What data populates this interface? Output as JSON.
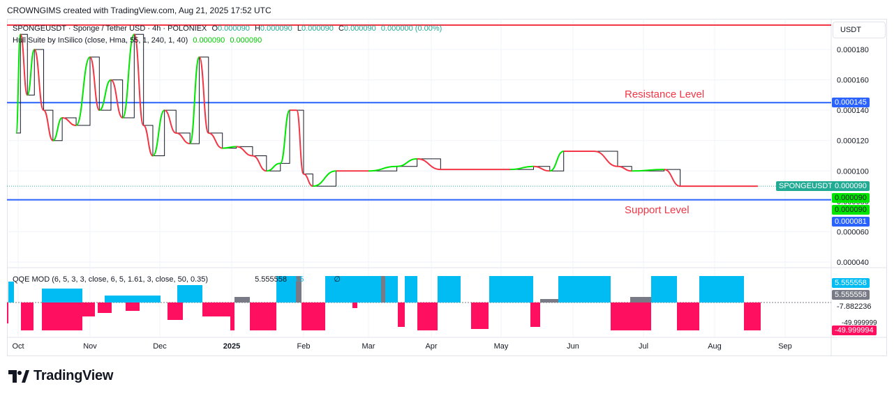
{
  "header": {
    "attribution": "CROWNGIMS created with TradingView.com, Aug 21, 2025 17:52 UTC"
  },
  "legend": {
    "symbol_line": "SPONGEUSDT · Sponge / Tether USD · 4h · POLONIEX",
    "o_label": "O",
    "o_value": "0.000090",
    "h_label": "H",
    "h_value": "0.000090",
    "l_label": "L",
    "l_value": "0.000090",
    "c_label": "C",
    "c_value": "0.000090",
    "change": "0.000000 (0.00%)",
    "indicator": "Hull Suite by InSilico (close, Hma, 55, 1, 240, 1, 40)",
    "indicator_v1": "0.000090",
    "indicator_v2": "0.000090",
    "qqe": "QQE MOD (6, 5, 3, 3, close, 6, 5, 1.61, 3, close, 50, 0.35)",
    "qqe_v1": "5.555558",
    "qqe_v2": "5.5",
    "qqe_symbol": "∅"
  },
  "annotations": {
    "resistance": "Resistance Level",
    "support": "Support Level"
  },
  "price_axis": {
    "currency": "USDT",
    "ticks": [
      "0.000180",
      "0.000160",
      "0.000140",
      "0.000120",
      "0.000100",
      "0.000080",
      "0.000060",
      "0.000040"
    ],
    "tags": {
      "resistance": "0.000145",
      "symbol": "SPONGEUSDT",
      "last": "0.000090",
      "hull1": "0.000090",
      "hull2": "0.000090",
      "support": "0.000081"
    }
  },
  "qqe_axis": {
    "v1": "5.555558",
    "v2": "5.555558",
    "v3": "-7.882236",
    "v4": "-49.999994",
    "v4_under": "-49.999999"
  },
  "time_axis": [
    "Oct",
    "Nov",
    "Dec",
    "2025",
    "Feb",
    "Mar",
    "Apr",
    "May",
    "Jun",
    "Jul",
    "Aug",
    "Sep"
  ],
  "colors": {
    "resistance_line": "#2962ff",
    "support_line": "#2962ff",
    "top_line": "#f23645",
    "hull_up": "#00e600",
    "hull_down": "#f23645",
    "price": "#131722",
    "qqe_up": "#00bcf2",
    "qqe_down": "#ff0f5f",
    "qqe_neutral": "#787b86",
    "last_tag": "#22ab94",
    "hull_tag": "#00e600",
    "annotation_text": "#f23645"
  },
  "chart_data": [
    {
      "type": "line",
      "title": "SPONGEUSDT · Sponge / Tether USD · 4h · POLONIEX",
      "x": [
        "Oct",
        "Nov",
        "Dec",
        "2025",
        "Feb",
        "Mar",
        "Apr",
        "May",
        "Jun",
        "Jul",
        "Aug",
        "Sep"
      ],
      "series": [
        {
          "name": "",
          "points": [
            [
              "Sep 30",
              0.000125
            ],
            [
              "Oct 2",
              0.00019
            ],
            [
              "Oct 5",
              0.00015
            ],
            [
              "Oct 8",
              0.00018
            ],
            [
              "Oct 12",
              0.00014
            ],
            [
              "Oct 16",
              0.00012
            ],
            [
              "Oct 20",
              0.000135
            ],
            [
              "Oct 26",
              0.00013
            ],
            [
              "Nov 1",
              0.000175
            ],
            [
              "Nov 5",
              0.00014
            ],
            [
              "Nov 10",
              0.00016
            ],
            [
              "Nov 15",
              0.000135
            ],
            [
              "Nov 20",
              0.00019
            ],
            [
              "Nov 24",
              0.00013
            ],
            [
              "Nov 28",
              0.00011
            ],
            [
              "Dec 3",
              0.00014
            ],
            [
              "Dec 8",
              0.000125
            ],
            [
              "Dec 14",
              0.000118
            ],
            [
              "Dec 18",
              0.000175
            ],
            [
              "Dec 22",
              0.000125
            ],
            [
              "Dec 28",
              0.000115
            ],
            [
              "Jan 3",
              0.000116
            ],
            [
              "Jan 10",
              0.00011
            ],
            [
              "Jan 16",
              0.0001
            ],
            [
              "Jan 22",
              0.000105
            ],
            [
              "Jan 26",
              0.00014
            ],
            [
              "Jan 29",
              0.00014
            ],
            [
              "Feb 1",
              9.8e-05
            ],
            [
              "Feb 5",
              9e-05
            ],
            [
              "Feb 15",
              0.0001
            ],
            [
              "Mar 1",
              0.0001
            ],
            [
              "Mar 15",
              0.000103
            ],
            [
              "Mar 25",
              0.000108
            ],
            [
              "Apr 5",
              0.000101
            ],
            [
              "Apr 20",
              0.000101
            ],
            [
              "May 5",
              0.000101
            ],
            [
              "May 15",
              0.000103
            ],
            [
              "May 22",
              0.0001
            ],
            [
              "May 28",
              0.000113
            ],
            [
              "Jun 10",
              0.000113
            ],
            [
              "Jun 20",
              0.000103
            ],
            [
              "Jun 26",
              0.0001
            ],
            [
              "Jul 10",
              0.000101
            ],
            [
              "Jul 17",
              9e-05
            ],
            [
              "Aug 1",
              9e-05
            ],
            [
              "Aug 20",
              9e-05
            ]
          ]
        }
      ],
      "annotations": [
        {
          "label": "Resistance Level",
          "y": 0.000145
        },
        {
          "label": "Support Level",
          "y": 8.1e-05
        }
      ],
      "ylim": [
        3.5e-05,
        0.000195
      ],
      "ylabel": "USDT",
      "grid": true
    },
    {
      "type": "bar",
      "title": "QQE MOD (6, 5, 3, 3, close, 6, 5, 1.61, 3, close, 50, 0.35)",
      "x": [
        "Oct",
        "Nov",
        "Dec",
        "2025",
        "Feb",
        "Mar",
        "Apr",
        "May",
        "Jun",
        "Jul",
        "Aug",
        "Sep"
      ],
      "ylim": [
        -50,
        6
      ],
      "grid": false
    }
  ]
}
